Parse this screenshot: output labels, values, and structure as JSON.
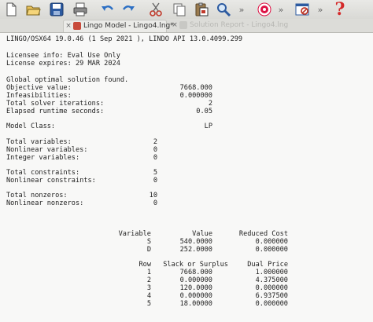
{
  "toolbar": {
    "icons": [
      "new-file-icon",
      "open-folder-icon",
      "save-icon",
      "print-icon",
      "undo-icon",
      "redo-icon",
      "cut-icon",
      "copy-icon",
      "paste-icon",
      "find-icon",
      "more-chevron-icon",
      "target-icon",
      "more-chevron-icon",
      "window-x-icon",
      "more-chevron-icon",
      "help-icon"
    ]
  },
  "tabs": [
    {
      "close": "×",
      "label": "Lingo Model - Lingo4.lng*"
    },
    {
      "close": "×",
      "label": "Solution Report - Lingo4.lng"
    }
  ],
  "report": {
    "version_line": "LINGO/OSX64 19.0.46 (1 Sep 2021 ), LINDO API 13.0.4099.299",
    "license_info": "Licensee info: Eval Use Only",
    "license_expires": "License expires: 29 MAR 2024",
    "status": "Global optimal solution found.",
    "summary": [
      {
        "label": "Objective value:",
        "value": "7668.000"
      },
      {
        "label": "Infeasibilities:",
        "value": "0.000000"
      },
      {
        "label": "Total solver iterations:",
        "value": "2"
      },
      {
        "label": "Elapsed runtime seconds:",
        "value": "0.05"
      }
    ],
    "model_class": {
      "label": "Model Class:",
      "value": "LP"
    },
    "counts": [
      {
        "label": "Total variables:",
        "value": "2"
      },
      {
        "label": "Nonlinear variables:",
        "value": "0"
      },
      {
        "label": "Integer variables:",
        "value": "0"
      },
      {
        "label": "Total constraints:",
        "value": "5"
      },
      {
        "label": "Nonlinear constraints:",
        "value": "0"
      },
      {
        "label": "Total nonzeros:",
        "value": "10"
      },
      {
        "label": "Nonlinear nonzeros:",
        "value": "0"
      }
    ],
    "variables_headers": [
      "Variable",
      "Value",
      "Reduced Cost"
    ],
    "variables": [
      {
        "name": "S",
        "value": "540.0000",
        "reduced_cost": "0.000000"
      },
      {
        "name": "D",
        "value": "252.0000",
        "reduced_cost": "0.000000"
      }
    ],
    "rows_headers": [
      "Row",
      "Slack or Surplus",
      "Dual Price"
    ],
    "rows": [
      {
        "row": "1",
        "slack": "7668.000",
        "dual": "1.000000"
      },
      {
        "row": "2",
        "slack": "0.000000",
        "dual": "4.375000"
      },
      {
        "row": "3",
        "slack": "120.0000",
        "dual": "0.000000"
      },
      {
        "row": "4",
        "slack": "0.000000",
        "dual": "6.937500"
      },
      {
        "row": "5",
        "slack": "18.00000",
        "dual": "0.000000"
      }
    ]
  }
}
